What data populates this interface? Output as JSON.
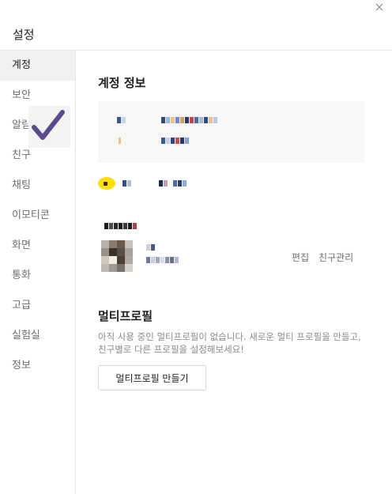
{
  "window": {
    "title": "설정"
  },
  "sidebar": {
    "items": [
      {
        "label": "계정",
        "active": true
      },
      {
        "label": "보안",
        "active": false
      },
      {
        "label": "알림",
        "active": false
      },
      {
        "label": "친구",
        "active": false
      },
      {
        "label": "채팅",
        "active": false
      },
      {
        "label": "이모티콘",
        "active": false
      },
      {
        "label": "화면",
        "active": false
      },
      {
        "label": "통화",
        "active": false
      },
      {
        "label": "고급",
        "active": false
      },
      {
        "label": "실험실",
        "active": false
      },
      {
        "label": "정보",
        "active": false
      }
    ]
  },
  "account": {
    "section_title": "계정 정보"
  },
  "profile": {
    "edit_label": "편집",
    "manage_friends_label": "친구관리"
  },
  "multiprofile": {
    "title": "멀티프로필",
    "description": "아직 사용 중인 멀티프로필이 없습니다. 새로운 멀티 프로필을 만들고, 친구별로 다른 프로필을 설정해보세요!",
    "button_label": "멀티프로필 만들기"
  },
  "icons": {
    "close": "close-icon",
    "check": "checkmark-icon"
  },
  "colors": {
    "accent_check": "#5c4a8c",
    "kakao_yellow": "#ffe000"
  }
}
